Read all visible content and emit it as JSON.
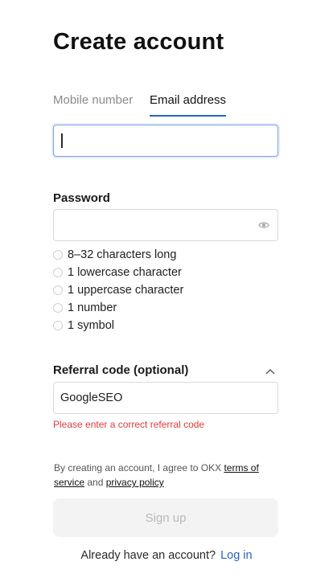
{
  "page": {
    "title": "Create account"
  },
  "tabs": [
    {
      "label": "Mobile number",
      "active": false
    },
    {
      "label": "Email address",
      "active": true
    }
  ],
  "email": {
    "value": "",
    "placeholder": ""
  },
  "password": {
    "label": "Password",
    "value": "",
    "rules": [
      "8–32 characters long",
      "1 lowercase character",
      "1 uppercase character",
      "1 number",
      "1 symbol"
    ]
  },
  "referral": {
    "label": "Referral code (optional)",
    "value": "GoogleSEO",
    "error": "Please enter a correct referral code"
  },
  "terms": {
    "prefix": "By creating an account, I agree to OKX ",
    "terms_link": "terms of service",
    "and": " and ",
    "privacy_link": "privacy policy"
  },
  "signup": {
    "label": "Sign up"
  },
  "login_prompt": {
    "text": "Already have an account?",
    "link": "Log in"
  },
  "colors": {
    "accent": "#2a62c7",
    "error": "#e23b3b",
    "disabled_bg": "#f3f3f3",
    "disabled_text": "#b8b8b8"
  },
  "icons": {
    "password_visibility": "eye-icon",
    "referral_toggle": "chevron-up-icon"
  }
}
